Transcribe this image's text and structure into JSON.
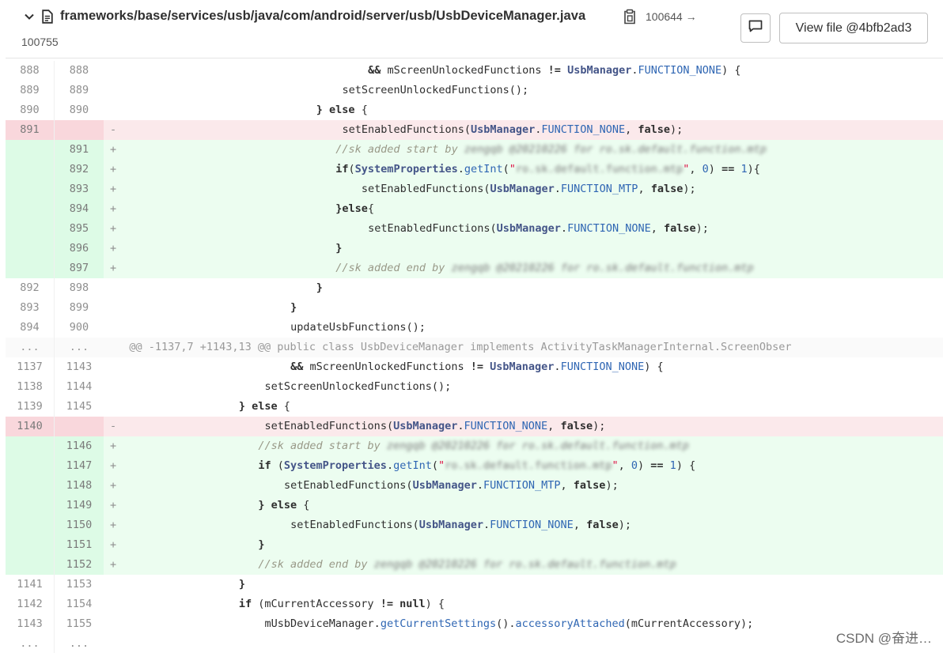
{
  "header": {
    "file_path": "frameworks/base/services/usb/java/com/android/server/usb/UsbDeviceManager.java",
    "mode_change": "100644 →",
    "mode_new": "100755",
    "view_file_label": "View file @4bfb2ad3"
  },
  "rows": [
    {
      "type": "ctx",
      "old": "888",
      "new": "888",
      "indent": 38,
      "parts": [
        [
          "k",
          "&& "
        ],
        [
          "",
          "mScreenUnlockedFunctions "
        ],
        [
          "k",
          "!= "
        ],
        [
          "t",
          "UsbManager"
        ],
        [
          "",
          "."
        ],
        [
          "n",
          "FUNCTION_NONE"
        ],
        [
          "",
          ") {"
        ]
      ]
    },
    {
      "type": "ctx",
      "old": "889",
      "new": "889",
      "indent": 34,
      "parts": [
        [
          "",
          "setScreenUnlockedFunctions();"
        ]
      ]
    },
    {
      "type": "ctx",
      "old": "890",
      "new": "890",
      "indent": 30,
      "parts": [
        [
          "k",
          "} else "
        ],
        [
          "",
          "{"
        ]
      ]
    },
    {
      "type": "del",
      "old": "891",
      "new": "",
      "indent": 34,
      "parts": [
        [
          "",
          "setEnabledFunctions("
        ],
        [
          "t",
          "UsbManager"
        ],
        [
          "",
          "."
        ],
        [
          "n",
          "FUNCTION_NONE"
        ],
        [
          "",
          ", "
        ],
        [
          "k",
          "false"
        ],
        [
          "",
          ");"
        ]
      ]
    },
    {
      "type": "add",
      "old": "",
      "new": "891",
      "indent": 33,
      "parts": [
        [
          "c",
          "//sk added start by "
        ],
        [
          "cb",
          "zengqb @20210226 for ro.sk.default.function.mtp"
        ]
      ]
    },
    {
      "type": "add",
      "old": "",
      "new": "892",
      "indent": 33,
      "parts": [
        [
          "k",
          "if"
        ],
        [
          "",
          "("
        ],
        [
          "t",
          "SystemProperties"
        ],
        [
          "",
          "."
        ],
        [
          "f",
          "getInt"
        ],
        [
          "",
          "("
        ],
        [
          "s",
          "\""
        ],
        [
          "sb",
          "ro.sk.default.function.mtp"
        ],
        [
          "s",
          "\""
        ],
        [
          "",
          ", "
        ],
        [
          "n",
          "0"
        ],
        [
          "",
          ") "
        ],
        [
          "k",
          "=="
        ],
        [
          "n",
          " 1"
        ],
        [
          "",
          "){"
        ]
      ]
    },
    {
      "type": "add",
      "old": "",
      "new": "893",
      "indent": 37,
      "parts": [
        [
          "",
          "setEnabledFunctions("
        ],
        [
          "t",
          "UsbManager"
        ],
        [
          "",
          "."
        ],
        [
          "n",
          "FUNCTION_MTP"
        ],
        [
          "",
          ", "
        ],
        [
          "k",
          "false"
        ],
        [
          "",
          ");"
        ]
      ]
    },
    {
      "type": "add",
      "old": "",
      "new": "894",
      "indent": 33,
      "parts": [
        [
          "k",
          "}else"
        ],
        [
          "",
          "{"
        ]
      ]
    },
    {
      "type": "add",
      "old": "",
      "new": "895",
      "indent": 38,
      "parts": [
        [
          "",
          "setEnabledFunctions("
        ],
        [
          "t",
          "UsbManager"
        ],
        [
          "",
          "."
        ],
        [
          "n",
          "FUNCTION_NONE"
        ],
        [
          "",
          ", "
        ],
        [
          "k",
          "false"
        ],
        [
          "",
          ");"
        ]
      ]
    },
    {
      "type": "add",
      "old": "",
      "new": "896",
      "indent": 33,
      "parts": [
        [
          "k",
          "}"
        ]
      ]
    },
    {
      "type": "add",
      "old": "",
      "new": "897",
      "indent": 33,
      "parts": [
        [
          "c",
          "//sk added end by "
        ],
        [
          "cb",
          "zengqb @20210226 for ro.sk.default.function.mtp"
        ]
      ]
    },
    {
      "type": "ctx",
      "old": "892",
      "new": "898",
      "indent": 30,
      "parts": [
        [
          "k",
          "}"
        ]
      ]
    },
    {
      "type": "ctx",
      "old": "893",
      "new": "899",
      "indent": 26,
      "parts": [
        [
          "k",
          "}"
        ]
      ]
    },
    {
      "type": "ctx",
      "old": "894",
      "new": "900",
      "indent": 26,
      "parts": [
        [
          "",
          "updateUsbFunctions();"
        ]
      ]
    },
    {
      "type": "hunk",
      "old": "...",
      "new": "...",
      "indent": 2,
      "parts": [
        [
          "",
          "@@ -1137,7 +1143,13 @@ public class UsbDeviceManager implements ActivityTaskManagerInternal.ScreenObser"
        ]
      ]
    },
    {
      "type": "ctx",
      "old": "1137",
      "new": "1143",
      "indent": 26,
      "parts": [
        [
          "k",
          "&& "
        ],
        [
          "",
          "mScreenUnlockedFunctions "
        ],
        [
          "k",
          "!= "
        ],
        [
          "t",
          "UsbManager"
        ],
        [
          "",
          "."
        ],
        [
          "n",
          "FUNCTION_NONE"
        ],
        [
          "",
          ") {"
        ]
      ]
    },
    {
      "type": "ctx",
      "old": "1138",
      "new": "1144",
      "indent": 22,
      "parts": [
        [
          "",
          "setScreenUnlockedFunctions();"
        ]
      ]
    },
    {
      "type": "ctx",
      "old": "1139",
      "new": "1145",
      "indent": 18,
      "parts": [
        [
          "k",
          "} else "
        ],
        [
          "",
          "{"
        ]
      ]
    },
    {
      "type": "del",
      "old": "1140",
      "new": "",
      "indent": 22,
      "parts": [
        [
          "",
          "setEnabledFunctions("
        ],
        [
          "t",
          "UsbManager"
        ],
        [
          "",
          "."
        ],
        [
          "n",
          "FUNCTION_NONE"
        ],
        [
          "",
          ", "
        ],
        [
          "k",
          "false"
        ],
        [
          "",
          ");"
        ]
      ]
    },
    {
      "type": "add",
      "old": "",
      "new": "1146",
      "indent": 21,
      "parts": [
        [
          "c",
          "//sk added start by "
        ],
        [
          "cb",
          "zengqb @20210226 for ro.sk.default.function.mtp"
        ]
      ]
    },
    {
      "type": "add",
      "old": "",
      "new": "1147",
      "indent": 21,
      "parts": [
        [
          "k",
          "if "
        ],
        [
          "",
          "("
        ],
        [
          "t",
          "SystemProperties"
        ],
        [
          "",
          "."
        ],
        [
          "f",
          "getInt"
        ],
        [
          "",
          "("
        ],
        [
          "s",
          "\""
        ],
        [
          "sb",
          "ro.sk.default.function.mtp"
        ],
        [
          "s",
          "\""
        ],
        [
          "",
          ", "
        ],
        [
          "n",
          "0"
        ],
        [
          "",
          ") "
        ],
        [
          "k",
          "=="
        ],
        [
          "n",
          " 1"
        ],
        [
          "",
          ") {"
        ]
      ]
    },
    {
      "type": "add",
      "old": "",
      "new": "1148",
      "indent": 25,
      "parts": [
        [
          "",
          "setEnabledFunctions("
        ],
        [
          "t",
          "UsbManager"
        ],
        [
          "",
          "."
        ],
        [
          "n",
          "FUNCTION_MTP"
        ],
        [
          "",
          ", "
        ],
        [
          "k",
          "false"
        ],
        [
          "",
          ");"
        ]
      ]
    },
    {
      "type": "add",
      "old": "",
      "new": "1149",
      "indent": 21,
      "parts": [
        [
          "k",
          "} else "
        ],
        [
          "",
          "{"
        ]
      ]
    },
    {
      "type": "add",
      "old": "",
      "new": "1150",
      "indent": 26,
      "parts": [
        [
          "",
          "setEnabledFunctions("
        ],
        [
          "t",
          "UsbManager"
        ],
        [
          "",
          "."
        ],
        [
          "n",
          "FUNCTION_NONE"
        ],
        [
          "",
          ", "
        ],
        [
          "k",
          "false"
        ],
        [
          "",
          ");"
        ]
      ]
    },
    {
      "type": "add",
      "old": "",
      "new": "1151",
      "indent": 21,
      "parts": [
        [
          "k",
          "}"
        ]
      ]
    },
    {
      "type": "add",
      "old": "",
      "new": "1152",
      "indent": 21,
      "parts": [
        [
          "c",
          "//sk added end by "
        ],
        [
          "cb",
          "zengqb @20210226 for ro.sk.default.function.mtp"
        ]
      ]
    },
    {
      "type": "ctx",
      "old": "1141",
      "new": "1153",
      "indent": 18,
      "parts": [
        [
          "k",
          "}"
        ]
      ]
    },
    {
      "type": "ctx",
      "old": "1142",
      "new": "1154",
      "indent": 18,
      "parts": [
        [
          "k",
          "if "
        ],
        [
          "",
          "(mCurrentAccessory "
        ],
        [
          "k",
          "!= null"
        ],
        [
          "",
          ") {"
        ]
      ]
    },
    {
      "type": "ctx",
      "old": "1143",
      "new": "1155",
      "indent": 22,
      "parts": [
        [
          "",
          "mUsbDeviceManager."
        ],
        [
          "f",
          "getCurrentSettings"
        ],
        [
          "",
          "()."
        ],
        [
          "f",
          "accessoryAttached"
        ],
        [
          "",
          "(mCurrentAccessory);"
        ]
      ]
    },
    {
      "type": "ctx",
      "old": "...",
      "new": "...",
      "indent": 0,
      "parts": []
    }
  ],
  "watermark": "CSDN @奋进…"
}
